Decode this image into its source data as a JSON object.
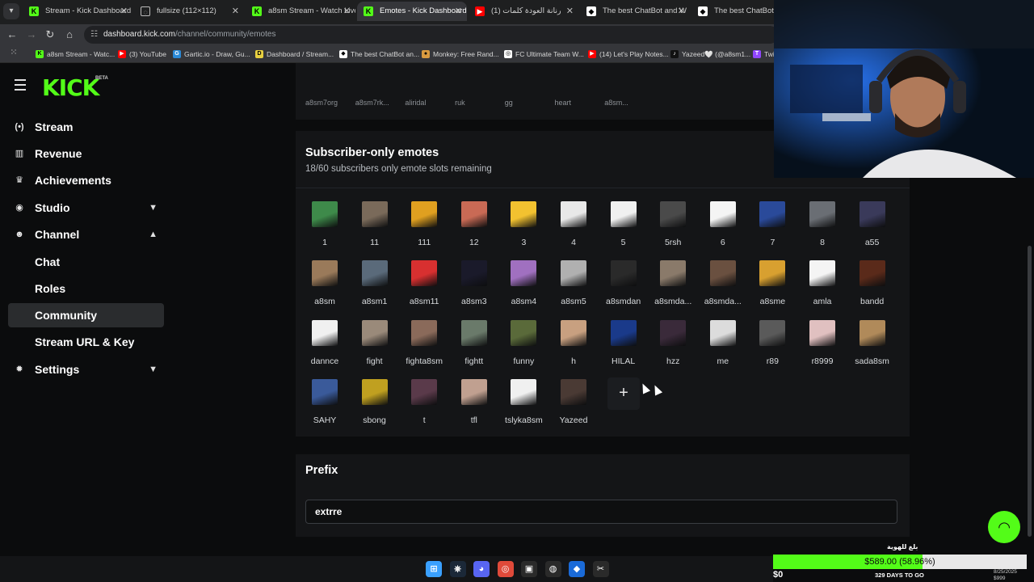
{
  "browser": {
    "tabs": [
      {
        "title": "Stream - Kick Dashboard",
        "icon": "kick",
        "active": false
      },
      {
        "title": "fullsize (112×112)",
        "icon": "globe",
        "active": false
      },
      {
        "title": "a8sm Stream - Watch Live",
        "icon": "kick",
        "active": false
      },
      {
        "title": "Emotes - Kick Dashboard",
        "icon": "kick",
        "active": true
      },
      {
        "title": "(1) رنانة العودة كلمات",
        "icon": "youtube",
        "active": false
      },
      {
        "title": "The best ChatBot and W",
        "icon": "bot",
        "active": false
      },
      {
        "title": "The best ChatBot and",
        "icon": "bot",
        "active": false
      }
    ],
    "url_host": "dashboard.kick.com",
    "url_path": "/channel/community/emotes",
    "bookmarks": [
      {
        "label": "a8sm Stream - Watc...",
        "icon": "kick"
      },
      {
        "label": "(3) YouTube",
        "icon": "youtube"
      },
      {
        "label": "Gartic.io - Draw, Gu...",
        "icon": "gartic"
      },
      {
        "label": "Dashboard / Stream...",
        "icon": "dash"
      },
      {
        "label": "The best ChatBot an...",
        "icon": "bot"
      },
      {
        "label": "Monkey: Free Rand...",
        "icon": "monkey"
      },
      {
        "label": "FC Ultimate Team W...",
        "icon": "fc"
      },
      {
        "label": "(14) Let's Play Notes...",
        "icon": "youtube"
      },
      {
        "label": "Yazeed🤍 (@a8sm1...",
        "icon": "tiktok"
      },
      {
        "label": "Twi",
        "icon": "twitch"
      }
    ]
  },
  "brand": {
    "logo": "KICK",
    "beta": "BETA",
    "accent": "#53fc18"
  },
  "sidebar": {
    "items": [
      {
        "label": "Stream",
        "icon": "broadcast-icon",
        "glyph": "(•)"
      },
      {
        "label": "Revenue",
        "icon": "chart-icon",
        "glyph": "▥"
      },
      {
        "label": "Achievements",
        "icon": "trophy-icon",
        "glyph": "♛"
      },
      {
        "label": "Studio",
        "icon": "camera-icon",
        "glyph": "◉",
        "chevron": "▼"
      },
      {
        "label": "Channel",
        "icon": "users-icon",
        "glyph": "☻",
        "chevron": "▲"
      },
      {
        "label": "Chat",
        "sub": true
      },
      {
        "label": "Roles",
        "sub": true
      },
      {
        "label": "Community",
        "sub": true,
        "active": true
      },
      {
        "label": "Stream URL & Key",
        "sub": true
      },
      {
        "label": "Settings",
        "icon": "gear-icon",
        "glyph": "✹",
        "chevron": "▼"
      }
    ]
  },
  "emotes_section": {
    "cut_labels": [
      "a8sm7org",
      "a8sm7rk...",
      "aliridal",
      "ruk",
      "gg",
      "heart",
      "a8sm..."
    ],
    "title": "Subscriber-only emotes",
    "subtitle": "18/60 subscribers only emote slots remaining",
    "emotes": [
      {
        "name": "1",
        "color": "#3e8a4a"
      },
      {
        "name": "11",
        "color": "#7a6a5a"
      },
      {
        "name": "111",
        "color": "#e0a020"
      },
      {
        "name": "12",
        "color": "#c96a55"
      },
      {
        "name": "3",
        "color": "#f2c230"
      },
      {
        "name": "4",
        "color": "#e8e8e8"
      },
      {
        "name": "5",
        "color": "#f0f0f0"
      },
      {
        "name": "5rsh",
        "color": "#4a4a4a"
      },
      {
        "name": "6",
        "color": "#f4f4f4"
      },
      {
        "name": "7",
        "color": "#2a4a9a"
      },
      {
        "name": "8",
        "color": "#6a6e74"
      },
      {
        "name": "a55",
        "color": "#3a3a5a"
      },
      {
        "name": "a8sm",
        "color": "#9a7a5a"
      },
      {
        "name": "a8sm1",
        "color": "#5a6a7a"
      },
      {
        "name": "a8sm11",
        "color": "#d83030"
      },
      {
        "name": "a8sm3",
        "color": "#1a1a2a"
      },
      {
        "name": "a8sm4",
        "color": "#a070c0"
      },
      {
        "name": "a8sm5",
        "color": "#b0b0b0"
      },
      {
        "name": "a8smdan",
        "color": "#2a2a2a"
      },
      {
        "name": "a8smda...",
        "color": "#8a7a6a"
      },
      {
        "name": "a8smda...",
        "color": "#6a5040"
      },
      {
        "name": "a8sme",
        "color": "#d8a030"
      },
      {
        "name": "amla",
        "color": "#f4f4f4"
      },
      {
        "name": "bandd",
        "color": "#5a2a1a"
      },
      {
        "name": "dannce",
        "color": "#f0f0f0"
      },
      {
        "name": "fight",
        "color": "#9a8a7a"
      },
      {
        "name": "fighta8sm",
        "color": "#8a6a5a"
      },
      {
        "name": "fightt",
        "color": "#6a7a6a"
      },
      {
        "name": "funny",
        "color": "#5a6a3a"
      },
      {
        "name": "h",
        "color": "#c8a080"
      },
      {
        "name": "HILAL",
        "color": "#1a3a8a"
      },
      {
        "name": "hzz",
        "color": "#3a2a3a"
      },
      {
        "name": "me",
        "color": "#dcdcdc"
      },
      {
        "name": "r89",
        "color": "#5a5a5a"
      },
      {
        "name": "r8999",
        "color": "#e0c0c0"
      },
      {
        "name": "sada8sm",
        "color": "#b08a5a"
      },
      {
        "name": "SAHY",
        "color": "#3a5a9a"
      },
      {
        "name": "sbong",
        "color": "#c0a020"
      },
      {
        "name": "t",
        "color": "#5a3a4a"
      },
      {
        "name": "tfl",
        "color": "#c0a090"
      },
      {
        "name": "tslyka8sm",
        "color": "#f0f0f0"
      },
      {
        "name": "Yazeed",
        "color": "#4a3a34"
      }
    ],
    "add_label": "+"
  },
  "prefix": {
    "title": "Prefix",
    "value": "extrre"
  },
  "donation": {
    "label": "بلغ للهوية",
    "amount_text": "$589.00 (58.96%)",
    "progress": 0.5896,
    "left": "$0",
    "days": "329 DAYS TO GO",
    "date": "8/25/2025",
    "goal": "$999"
  },
  "taskbar": [
    {
      "icon": "windows-icon",
      "glyph": "⊞",
      "color": "#3aa0ff"
    },
    {
      "icon": "steam-icon",
      "glyph": "⎈",
      "color": "#1b2838"
    },
    {
      "icon": "discord-icon",
      "glyph": "◕",
      "color": "#5865f2"
    },
    {
      "icon": "chrome-icon",
      "glyph": "◎",
      "color": "#e04a3a"
    },
    {
      "icon": "capture-icon",
      "glyph": "▣",
      "color": "#2a2a2a"
    },
    {
      "icon": "obs-icon",
      "glyph": "◍",
      "color": "#2a2a2a"
    },
    {
      "icon": "browser-icon",
      "glyph": "◆",
      "color": "#1a6ad8"
    },
    {
      "icon": "capcut-icon",
      "glyph": "✂",
      "color": "#2a2a2a"
    }
  ]
}
